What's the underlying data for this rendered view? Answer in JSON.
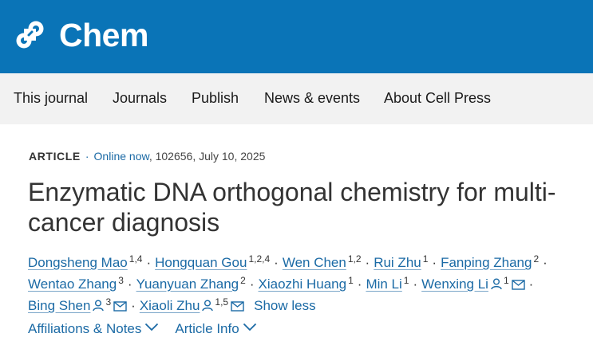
{
  "brand": {
    "name": "Chem"
  },
  "nav": {
    "items": [
      "This journal",
      "Journals",
      "Publish",
      "News & events",
      "About Cell Press"
    ]
  },
  "article": {
    "type": "ARTICLE",
    "status": "Online now",
    "details": ", 102656, July 10, 2025",
    "title": "Enzymatic DNA orthogonal chemistry for multi-cancer diagnosis"
  },
  "authors": [
    {
      "name": "Dongsheng Mao",
      "aff": "1,4"
    },
    {
      "name": "Hongquan Gou",
      "aff": "1,2,4"
    },
    {
      "name": "Wen Chen",
      "aff": "1,2"
    },
    {
      "name": "Rui Zhu",
      "aff": "1"
    },
    {
      "name": "Fanping Zhang",
      "aff": "2"
    },
    {
      "name": "Wentao Zhang",
      "aff": "3"
    },
    {
      "name": "Yuanyuan Zhang",
      "aff": "2"
    },
    {
      "name": "Xiaozhi Huang",
      "aff": "1"
    },
    {
      "name": "Min Li",
      "aff": "1"
    },
    {
      "name": "Wenxing Li",
      "aff": "1"
    },
    {
      "name": "Bing Shen",
      "aff": "3"
    },
    {
      "name": "Xiaoli Zhu",
      "aff": "1,5"
    }
  ],
  "author_controls": {
    "show_less": "Show less"
  },
  "toggles": {
    "affiliations": "Affiliations & Notes",
    "article_info": "Article Info"
  },
  "colors": {
    "brand_blue": "#0a74b7",
    "link_blue": "#1b6aa5",
    "nav_bg": "#f2f2f2"
  },
  "icons": [
    "chem-logo-icon",
    "person-icon",
    "envelope-icon",
    "chevron-down-icon"
  ]
}
